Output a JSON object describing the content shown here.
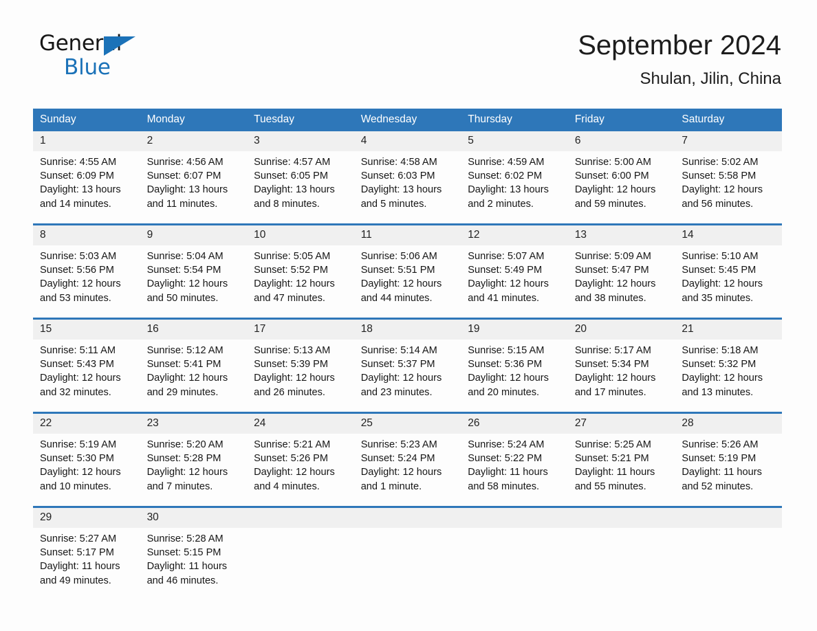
{
  "brand": {
    "word_general": "General",
    "word_blue": "Blue",
    "triangle_color": "#1B72B8"
  },
  "header": {
    "month_title": "September 2024",
    "location": "Shulan, Jilin, China"
  },
  "theme": {
    "header_blue": "#2E77B9",
    "daynum_band": "#F0F0F0",
    "page_background": "#FDFDFD",
    "text": "#161616"
  },
  "calendar": {
    "weekday_headers": [
      "Sunday",
      "Monday",
      "Tuesday",
      "Wednesday",
      "Thursday",
      "Friday",
      "Saturday"
    ],
    "weeks": [
      [
        {
          "day": "1",
          "sunrise": "Sunrise: 4:55 AM",
          "sunset": "Sunset: 6:09 PM",
          "daylight_line1": "Daylight: 13 hours",
          "daylight_line2": "and 14 minutes."
        },
        {
          "day": "2",
          "sunrise": "Sunrise: 4:56 AM",
          "sunset": "Sunset: 6:07 PM",
          "daylight_line1": "Daylight: 13 hours",
          "daylight_line2": "and 11 minutes."
        },
        {
          "day": "3",
          "sunrise": "Sunrise: 4:57 AM",
          "sunset": "Sunset: 6:05 PM",
          "daylight_line1": "Daylight: 13 hours",
          "daylight_line2": "and 8 minutes."
        },
        {
          "day": "4",
          "sunrise": "Sunrise: 4:58 AM",
          "sunset": "Sunset: 6:03 PM",
          "daylight_line1": "Daylight: 13 hours",
          "daylight_line2": "and 5 minutes."
        },
        {
          "day": "5",
          "sunrise": "Sunrise: 4:59 AM",
          "sunset": "Sunset: 6:02 PM",
          "daylight_line1": "Daylight: 13 hours",
          "daylight_line2": "and 2 minutes."
        },
        {
          "day": "6",
          "sunrise": "Sunrise: 5:00 AM",
          "sunset": "Sunset: 6:00 PM",
          "daylight_line1": "Daylight: 12 hours",
          "daylight_line2": "and 59 minutes."
        },
        {
          "day": "7",
          "sunrise": "Sunrise: 5:02 AM",
          "sunset": "Sunset: 5:58 PM",
          "daylight_line1": "Daylight: 12 hours",
          "daylight_line2": "and 56 minutes."
        }
      ],
      [
        {
          "day": "8",
          "sunrise": "Sunrise: 5:03 AM",
          "sunset": "Sunset: 5:56 PM",
          "daylight_line1": "Daylight: 12 hours",
          "daylight_line2": "and 53 minutes."
        },
        {
          "day": "9",
          "sunrise": "Sunrise: 5:04 AM",
          "sunset": "Sunset: 5:54 PM",
          "daylight_line1": "Daylight: 12 hours",
          "daylight_line2": "and 50 minutes."
        },
        {
          "day": "10",
          "sunrise": "Sunrise: 5:05 AM",
          "sunset": "Sunset: 5:52 PM",
          "daylight_line1": "Daylight: 12 hours",
          "daylight_line2": "and 47 minutes."
        },
        {
          "day": "11",
          "sunrise": "Sunrise: 5:06 AM",
          "sunset": "Sunset: 5:51 PM",
          "daylight_line1": "Daylight: 12 hours",
          "daylight_line2": "and 44 minutes."
        },
        {
          "day": "12",
          "sunrise": "Sunrise: 5:07 AM",
          "sunset": "Sunset: 5:49 PM",
          "daylight_line1": "Daylight: 12 hours",
          "daylight_line2": "and 41 minutes."
        },
        {
          "day": "13",
          "sunrise": "Sunrise: 5:09 AM",
          "sunset": "Sunset: 5:47 PM",
          "daylight_line1": "Daylight: 12 hours",
          "daylight_line2": "and 38 minutes."
        },
        {
          "day": "14",
          "sunrise": "Sunrise: 5:10 AM",
          "sunset": "Sunset: 5:45 PM",
          "daylight_line1": "Daylight: 12 hours",
          "daylight_line2": "and 35 minutes."
        }
      ],
      [
        {
          "day": "15",
          "sunrise": "Sunrise: 5:11 AM",
          "sunset": "Sunset: 5:43 PM",
          "daylight_line1": "Daylight: 12 hours",
          "daylight_line2": "and 32 minutes."
        },
        {
          "day": "16",
          "sunrise": "Sunrise: 5:12 AM",
          "sunset": "Sunset: 5:41 PM",
          "daylight_line1": "Daylight: 12 hours",
          "daylight_line2": "and 29 minutes."
        },
        {
          "day": "17",
          "sunrise": "Sunrise: 5:13 AM",
          "sunset": "Sunset: 5:39 PM",
          "daylight_line1": "Daylight: 12 hours",
          "daylight_line2": "and 26 minutes."
        },
        {
          "day": "18",
          "sunrise": "Sunrise: 5:14 AM",
          "sunset": "Sunset: 5:37 PM",
          "daylight_line1": "Daylight: 12 hours",
          "daylight_line2": "and 23 minutes."
        },
        {
          "day": "19",
          "sunrise": "Sunrise: 5:15 AM",
          "sunset": "Sunset: 5:36 PM",
          "daylight_line1": "Daylight: 12 hours",
          "daylight_line2": "and 20 minutes."
        },
        {
          "day": "20",
          "sunrise": "Sunrise: 5:17 AM",
          "sunset": "Sunset: 5:34 PM",
          "daylight_line1": "Daylight: 12 hours",
          "daylight_line2": "and 17 minutes."
        },
        {
          "day": "21",
          "sunrise": "Sunrise: 5:18 AM",
          "sunset": "Sunset: 5:32 PM",
          "daylight_line1": "Daylight: 12 hours",
          "daylight_line2": "and 13 minutes."
        }
      ],
      [
        {
          "day": "22",
          "sunrise": "Sunrise: 5:19 AM",
          "sunset": "Sunset: 5:30 PM",
          "daylight_line1": "Daylight: 12 hours",
          "daylight_line2": "and 10 minutes."
        },
        {
          "day": "23",
          "sunrise": "Sunrise: 5:20 AM",
          "sunset": "Sunset: 5:28 PM",
          "daylight_line1": "Daylight: 12 hours",
          "daylight_line2": "and 7 minutes."
        },
        {
          "day": "24",
          "sunrise": "Sunrise: 5:21 AM",
          "sunset": "Sunset: 5:26 PM",
          "daylight_line1": "Daylight: 12 hours",
          "daylight_line2": "and 4 minutes."
        },
        {
          "day": "25",
          "sunrise": "Sunrise: 5:23 AM",
          "sunset": "Sunset: 5:24 PM",
          "daylight_line1": "Daylight: 12 hours",
          "daylight_line2": "and 1 minute."
        },
        {
          "day": "26",
          "sunrise": "Sunrise: 5:24 AM",
          "sunset": "Sunset: 5:22 PM",
          "daylight_line1": "Daylight: 11 hours",
          "daylight_line2": "and 58 minutes."
        },
        {
          "day": "27",
          "sunrise": "Sunrise: 5:25 AM",
          "sunset": "Sunset: 5:21 PM",
          "daylight_line1": "Daylight: 11 hours",
          "daylight_line2": "and 55 minutes."
        },
        {
          "day": "28",
          "sunrise": "Sunrise: 5:26 AM",
          "sunset": "Sunset: 5:19 PM",
          "daylight_line1": "Daylight: 11 hours",
          "daylight_line2": "and 52 minutes."
        }
      ],
      [
        {
          "day": "29",
          "sunrise": "Sunrise: 5:27 AM",
          "sunset": "Sunset: 5:17 PM",
          "daylight_line1": "Daylight: 11 hours",
          "daylight_line2": "and 49 minutes."
        },
        {
          "day": "30",
          "sunrise": "Sunrise: 5:28 AM",
          "sunset": "Sunset: 5:15 PM",
          "daylight_line1": "Daylight: 11 hours",
          "daylight_line2": "and 46 minutes."
        },
        {
          "day": "",
          "sunrise": "",
          "sunset": "",
          "daylight_line1": "",
          "daylight_line2": ""
        },
        {
          "day": "",
          "sunrise": "",
          "sunset": "",
          "daylight_line1": "",
          "daylight_line2": ""
        },
        {
          "day": "",
          "sunrise": "",
          "sunset": "",
          "daylight_line1": "",
          "daylight_line2": ""
        },
        {
          "day": "",
          "sunrise": "",
          "sunset": "",
          "daylight_line1": "",
          "daylight_line2": ""
        },
        {
          "day": "",
          "sunrise": "",
          "sunset": "",
          "daylight_line1": "",
          "daylight_line2": ""
        }
      ]
    ]
  }
}
